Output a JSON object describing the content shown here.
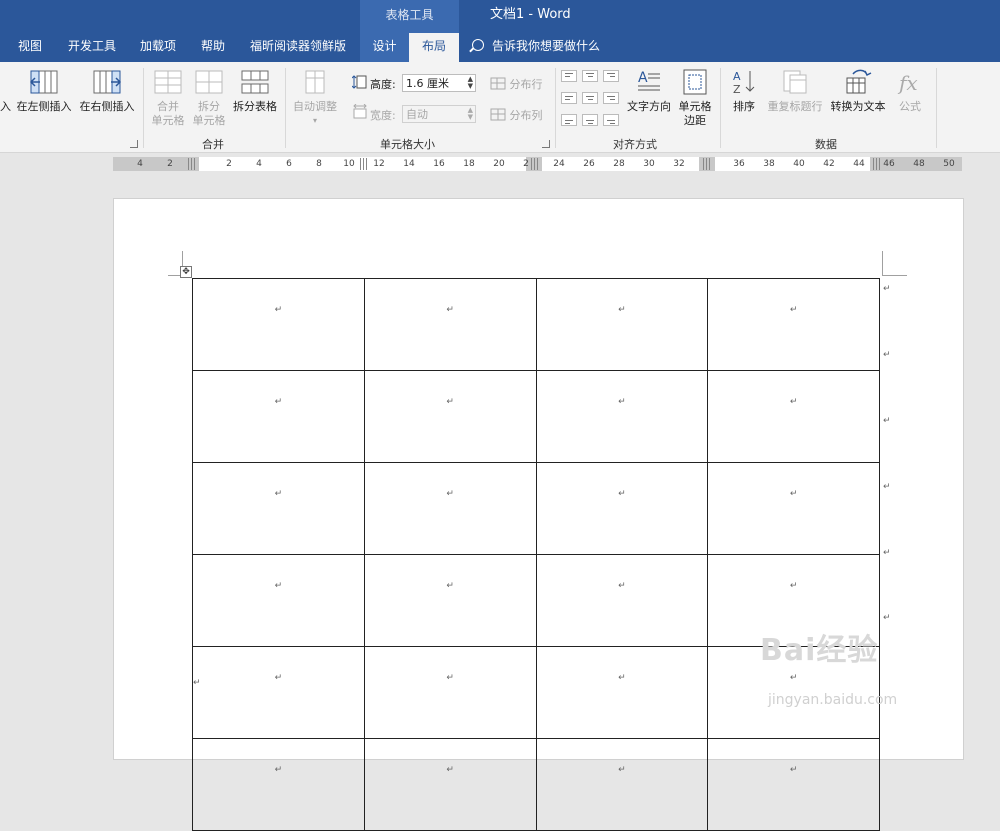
{
  "title_bar": {
    "context_title": "表格工具",
    "doc_title": "文档1  -  Word"
  },
  "tabs": [
    "视图",
    "开发工具",
    "加载项",
    "帮助",
    "福昕阅读器领鲜版",
    "设计",
    "布局"
  ],
  "tell_me": "告诉我你想要做什么",
  "ribbon": {
    "insert_cut": "入",
    "insert_left": "在左侧插入",
    "insert_right": "在右侧插入",
    "merge_cells": [
      "合并",
      "单元格"
    ],
    "split_cells": [
      "拆分",
      "单元格"
    ],
    "split_table": "拆分表格",
    "merge_group": "合并",
    "autofit": "自动调整",
    "height_label": "高度:",
    "height_value": "1.6 厘米",
    "width_label": "宽度:",
    "width_value": "自动",
    "distribute_rows": "分布行",
    "distribute_cols": "分布列",
    "cell_size_group": "单元格大小",
    "text_direction": "文字方向",
    "cell_margins": [
      "单元格",
      "边距"
    ],
    "alignment_group": "对齐方式",
    "sort": "排序",
    "repeat_header": "重复标题行",
    "convert_text": "转换为文本",
    "formula": "公式",
    "data_group": "数据"
  },
  "ruler": {
    "ticks": [
      "4",
      "2",
      "2",
      "4",
      "6",
      "8",
      "10",
      "12",
      "14",
      "16",
      "18",
      "20",
      "2",
      "24",
      "26",
      "28",
      "30",
      "32",
      "36",
      "38",
      "40",
      "42",
      "44",
      "46",
      "48",
      "50"
    ]
  },
  "table": {
    "paragraph_mark": "↵",
    "rows": [
      [
        "↵",
        "↵",
        "↵",
        "↵"
      ],
      [
        "↵",
        "↵",
        "↵",
        "↵"
      ],
      [
        "↵",
        "↵",
        "↵",
        "↵"
      ],
      [
        "↵",
        "↵",
        "↵",
        "↵"
      ],
      [
        "↵",
        "↵",
        "↵",
        "↵"
      ],
      [
        "↵",
        "↵",
        "↵",
        "↵"
      ]
    ]
  },
  "watermark": {
    "brand": "Bai经验",
    "url": "jingyan.baidu.com"
  },
  "colors": {
    "title_bar": "#2b579a",
    "context_tab": "#3b6ab0",
    "ribbon_bg": "#f3f3f3"
  },
  "icons": [
    "insert-left-icon",
    "insert-right-icon",
    "merge-cells-icon",
    "split-cells-icon",
    "split-table-icon",
    "autofit-icon",
    "height-icon",
    "width-icon",
    "distribute-rows-icon",
    "distribute-cols-icon",
    "text-direction-icon",
    "cell-margins-icon",
    "sort-icon",
    "repeat-header-icon",
    "convert-text-icon",
    "formula-icon",
    "search-icon",
    "table-move-icon"
  ]
}
